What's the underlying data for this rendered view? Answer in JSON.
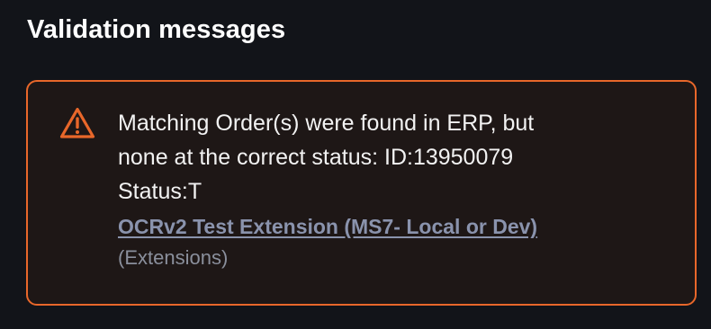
{
  "section": {
    "title": "Validation messages"
  },
  "alert": {
    "severity_icon": "warning-triangle-icon",
    "border_color": "#e8672a",
    "message_lines": [
      "Matching Order(s) were found in ERP, but",
      "none at the correct status: ID:13950079",
      "Status:T"
    ],
    "link_label": "OCRv2 Test Extension (MS7- Local or Dev)",
    "category_label": "(Extensions)"
  }
}
